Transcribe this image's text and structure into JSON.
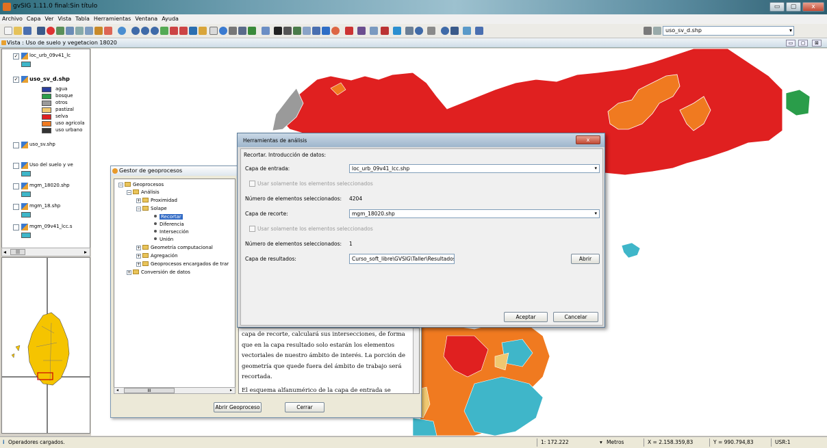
{
  "window": {
    "title": "gvSIG 1.11.0 final:Sin título",
    "min": "▭",
    "max": "▢",
    "close": "x"
  },
  "menu": [
    "Archivo",
    "Capa",
    "Ver",
    "Vista",
    "Tabla",
    "Herramientas",
    "Ventana",
    "Ayuda"
  ],
  "toolbar": {
    "layer_combo": "uso_sv_d.shp",
    "combo_arrow": "▾"
  },
  "view": {
    "title": "Vista : Uso de suelo y vegetacion 18020",
    "btn_min": "▭",
    "btn_max": "▢",
    "btn_close": "⊠"
  },
  "toc": {
    "layers": [
      {
        "name": "loc_urb_09v41_lc",
        "checked": "✓"
      },
      {
        "name": "uso_sv_d.shp",
        "checked": "✓"
      },
      {
        "name": "uso_sv.shp",
        "checked": ""
      },
      {
        "name": "Uso del suelo y ve",
        "checked": ""
      },
      {
        "name": "mgm_18020.shp",
        "checked": ""
      },
      {
        "name": "mgm_18.shp",
        "checked": ""
      },
      {
        "name": "mgm_09v41_lcc.s",
        "checked": ""
      }
    ],
    "legend": [
      {
        "label": "agua",
        "color": "#2b3f9e"
      },
      {
        "label": "bosque",
        "color": "#2a9d4a"
      },
      {
        "label": "otros",
        "color": "#9a9a9a"
      },
      {
        "label": "pastizal",
        "color": "#f0c870"
      },
      {
        "label": "selva",
        "color": "#e02020"
      },
      {
        "label": "uso agricola",
        "color": "#f07a20"
      },
      {
        "label": "uso urbano",
        "color": "#333333"
      }
    ],
    "scroll_left": "◂",
    "scroll_mid": "|||",
    "scroll_right": "▸"
  },
  "gestor": {
    "title": "Gestor de geoprocesos",
    "tree": [
      {
        "label": "Geoprocesos",
        "level": 0,
        "type": "folder",
        "exp": "−"
      },
      {
        "label": "Análisis",
        "level": 1,
        "type": "folder",
        "exp": "−"
      },
      {
        "label": "Proximidad",
        "level": 2,
        "type": "folder",
        "exp": "+"
      },
      {
        "label": "Solape",
        "level": 2,
        "type": "folder",
        "exp": "−"
      },
      {
        "label": "Recortar",
        "level": 3,
        "type": "leaf",
        "selected": true
      },
      {
        "label": "Diferencia",
        "level": 3,
        "type": "leaf"
      },
      {
        "label": "Intersección",
        "level": 3,
        "type": "leaf"
      },
      {
        "label": "Unión",
        "level": 3,
        "type": "leaf"
      },
      {
        "label": "Geometría computacional",
        "level": 2,
        "type": "folder",
        "exp": "+"
      },
      {
        "label": "Agregación",
        "level": 2,
        "type": "folder",
        "exp": "+"
      },
      {
        "label": "Geoprocesos encargados de trar",
        "level": 2,
        "type": "folder",
        "exp": "+"
      },
      {
        "label": "Conversión de datos",
        "level": 1,
        "type": "folder",
        "exp": "+"
      }
    ],
    "tree_scroll_left": "◂",
    "tree_scroll_mid": "III",
    "tree_scroll_right": "▸",
    "description": "capa de recorte, calculará sus intersecciones, de forma que en la capa resultado solo estarán los elementos vectoriales de nuestro ámbito de interés. La porción de geometría que quede fuera del ámbito de trabajo será recortada.",
    "description2": "El esquema alfanumérico de la capa de entrada se",
    "btn_open": "Abrir Geoproceso",
    "btn_close": "Cerrar"
  },
  "herr": {
    "title": "Herramientas de análisis",
    "close_glyph": "x",
    "heading": "Recortar. Introducción de datos:",
    "input_label": "Capa de entrada:",
    "input_value": "loc_urb_09v41_lcc.shp",
    "chk1": "Usar solamente los elementos seleccionados",
    "num1_label": "Número de elementos seleccionados:",
    "num1_value": "4204",
    "clip_label": "Capa de recorte:",
    "clip_value": "mgm_18020.shp",
    "chk2": "Usar solamente los elementos seleccionados",
    "num2_label": "Número de elementos seleccionados:",
    "num2_value": "1",
    "out_label": "Capa de resultados:",
    "out_value": "Curso_soft_libre\\GVSIG\\Taller\\Resultados\\",
    "btn_open": "Abrir",
    "btn_ok": "Aceptar",
    "btn_cancel": "Cancelar",
    "arrow": "▾"
  },
  "status": {
    "message": "Operadores cargados.",
    "scale": "1: 172.222",
    "units": "Metros",
    "x": "X = 2.158.359,83",
    "y": "Y = 990.794,83",
    "usr": "USR:1",
    "units_arrow": "▾"
  },
  "map_colors": {
    "selva": "#e02020",
    "agricola": "#f07a20",
    "agua": "#3fb6c9",
    "otros": "#9a9a9a",
    "bosque": "#2a9d4a",
    "pastizal": "#f0c870",
    "locator_fill": "#f5c400"
  }
}
